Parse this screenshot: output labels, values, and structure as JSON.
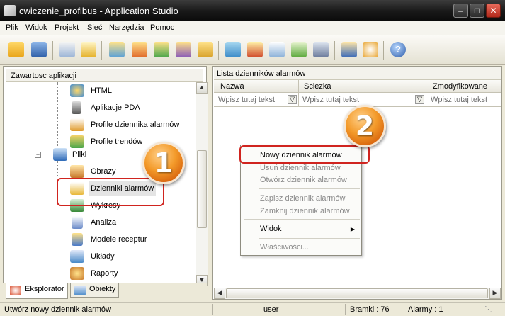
{
  "window": {
    "title": "cwiczenie_profibus - Application Studio"
  },
  "menu": {
    "items": [
      "Plik",
      "Widok",
      "Projekt",
      "Sieć",
      "Narzędzia",
      "Pomoc"
    ]
  },
  "toolbar": {
    "icons": [
      "open-folder-icon",
      "save-icon",
      "new-document-icon",
      "alarm-triangle-icon",
      "tags-icon",
      "screens-icon",
      "trends-icon",
      "recipes-icon",
      "scripts-icon",
      "layout-icon",
      "alarm-log-icon",
      "report-icon",
      "chart-icon",
      "print-icon",
      "transfer-icon",
      "network-icon",
      "help-icon"
    ]
  },
  "left_panel": {
    "header": "Zawartosc aplikacji",
    "tree": [
      {
        "label": "HTML",
        "icon": "html-icon"
      },
      {
        "label": "Aplikacje PDA",
        "icon": "pda-icon"
      },
      {
        "label": "Profile dziennika alarmów",
        "icon": "alarm-log-profile-icon"
      },
      {
        "label": "Profile trendów",
        "icon": "trend-profile-icon"
      },
      {
        "label": "Pliki",
        "icon": "files-icon"
      },
      {
        "label": "Obrazy",
        "icon": "images-icon"
      },
      {
        "label": "Dzienniki alarmów",
        "icon": "alarm-logs-icon"
      },
      {
        "label": "Wykresy",
        "icon": "charts-icon"
      },
      {
        "label": "Analiza",
        "icon": "analysis-icon"
      },
      {
        "label": "Modele receptur",
        "icon": "recipe-models-icon"
      },
      {
        "label": "Układy",
        "icon": "layouts-icon"
      },
      {
        "label": "Raporty",
        "icon": "reports-icon"
      }
    ],
    "tabs": [
      "Eksplorator",
      "Obiekty"
    ]
  },
  "right_panel": {
    "header": "Lista dzienników alarmów",
    "columns": [
      "Nazwa",
      "Sciezka",
      "Zmodyfikowane"
    ],
    "filter_placeholder": "Wpisz tutaj tekst"
  },
  "context_menu": {
    "new_log": "Nowy dziennik alarmów",
    "delete_log": "Usuń dziennik alarmów",
    "open_log": "Otwórz dziennik alarmów",
    "save_log": "Zapisz dziennik alarmów",
    "close_log": "Zamknij dziennik alarmów",
    "view": "Widok",
    "properties": "Właściwości..."
  },
  "badges": {
    "one": "1",
    "two": "2"
  },
  "status": {
    "message": "Utwórz nowy dziennik alarmów",
    "user": "user",
    "gates": "Bramki : 76",
    "alarms": "Alarmy : 1"
  },
  "colors": {
    "highlight_ring": "#d0241f",
    "badge": "#f39a2a"
  }
}
